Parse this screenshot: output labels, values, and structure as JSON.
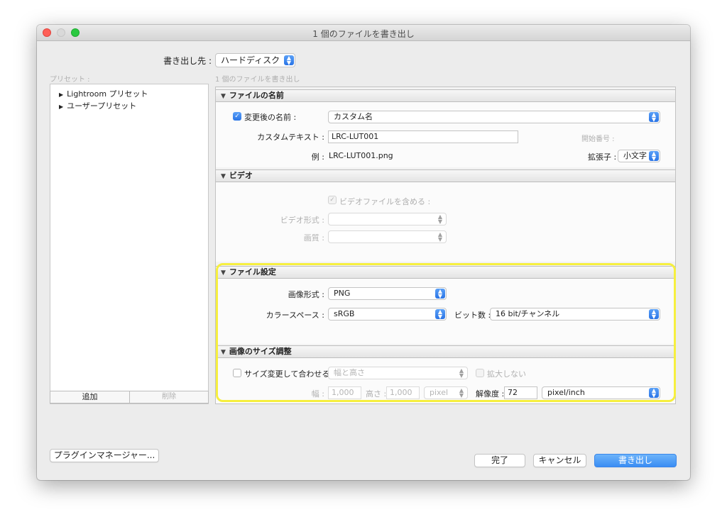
{
  "window": {
    "title": "1 個のファイルを書き出し"
  },
  "export_to": {
    "label": "書き出し先 :",
    "value": "ハードディスク"
  },
  "presets": {
    "header": "プリセット :",
    "items": [
      "Lightroom プリセット",
      "ユーザープリセット"
    ],
    "add_label": "追加",
    "remove_label": "削除"
  },
  "main": {
    "subtitle": "1 個のファイルを書き出し"
  },
  "file_naming": {
    "title": "ファイルの名前",
    "rename_label": "変更後の名前 :",
    "rename_value": "カスタム名",
    "custom_text_label": "カスタムテキスト :",
    "custom_text_value": "LRC-LUT001",
    "start_number_label": "開始番号 :",
    "example_label": "例 :",
    "example_value": "LRC-LUT001.png",
    "extension_label": "拡張子 :",
    "extension_value": "小文字"
  },
  "video": {
    "title": "ビデオ",
    "include_label": "ビデオファイルを含める :",
    "format_label": "ビデオ形式 :",
    "quality_label": "画質 :"
  },
  "file_settings": {
    "title": "ファイル設定",
    "format_label": "画像形式 :",
    "format_value": "PNG",
    "colorspace_label": "カラースペース :",
    "colorspace_value": "sRGB",
    "bitdepth_label": "ビット数 :",
    "bitdepth_value": "16 bit/チャンネル"
  },
  "image_sizing": {
    "title": "画像のサイズ調整",
    "resize_label": "サイズ変更して合わせる :",
    "resize_value": "幅と高さ",
    "no_enlarge_label": "拡大しない",
    "width_label": "幅 :",
    "width_value": "1,000",
    "height_label": "高さ :",
    "height_value": "1,000",
    "unit_value": "pixel",
    "resolution_label": "解像度 :",
    "resolution_value": "72",
    "resolution_unit": "pixel/inch"
  },
  "footer": {
    "plugin_manager": "プラグインマネージャー...",
    "done": "完了",
    "cancel": "キャンセル",
    "export": "書き出し"
  },
  "colors": {
    "highlight": "#f6ef3f",
    "accent": "#2a74e6"
  }
}
